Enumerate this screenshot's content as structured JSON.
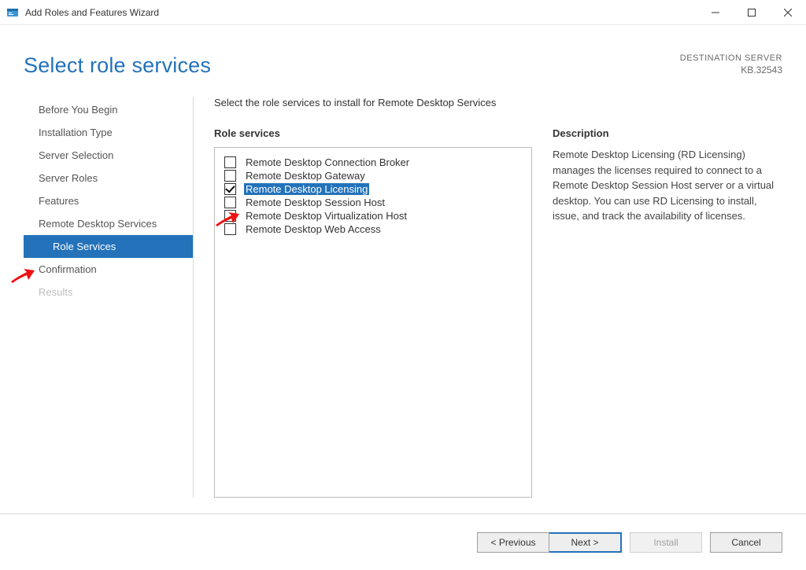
{
  "window": {
    "title": "Add Roles and Features Wizard"
  },
  "header": {
    "page_title": "Select role services",
    "destination_label": "DESTINATION SERVER",
    "destination_name": "KB.32543"
  },
  "sidebar": {
    "steps": [
      {
        "label": "Before You Begin"
      },
      {
        "label": "Installation Type"
      },
      {
        "label": "Server Selection"
      },
      {
        "label": "Server Roles"
      },
      {
        "label": "Features"
      },
      {
        "label": "Remote Desktop Services"
      },
      {
        "label": "Role Services",
        "sub": true,
        "active": true
      },
      {
        "label": "Confirmation"
      },
      {
        "label": "Results",
        "disabled": true
      }
    ]
  },
  "content": {
    "instruction": "Select the role services to install for Remote Desktop Services",
    "role_services_heading": "Role services",
    "description_heading": "Description",
    "role_services": [
      {
        "label": "Remote Desktop Connection Broker",
        "checked": false,
        "selected": false
      },
      {
        "label": "Remote Desktop Gateway",
        "checked": false,
        "selected": false
      },
      {
        "label": "Remote Desktop Licensing",
        "checked": true,
        "selected": true
      },
      {
        "label": "Remote Desktop Session Host",
        "checked": false,
        "selected": false
      },
      {
        "label": "Remote Desktop Virtualization Host",
        "checked": false,
        "selected": false
      },
      {
        "label": "Remote Desktop Web Access",
        "checked": false,
        "selected": false
      }
    ],
    "description_text": "Remote Desktop Licensing (RD Licensing) manages the licenses required to connect to a Remote Desktop Session Host server or a virtual desktop. You can use RD Licensing to install, issue, and track the availability of licenses."
  },
  "footer": {
    "previous": "< Previous",
    "next": "Next >",
    "install": "Install",
    "cancel": "Cancel"
  }
}
